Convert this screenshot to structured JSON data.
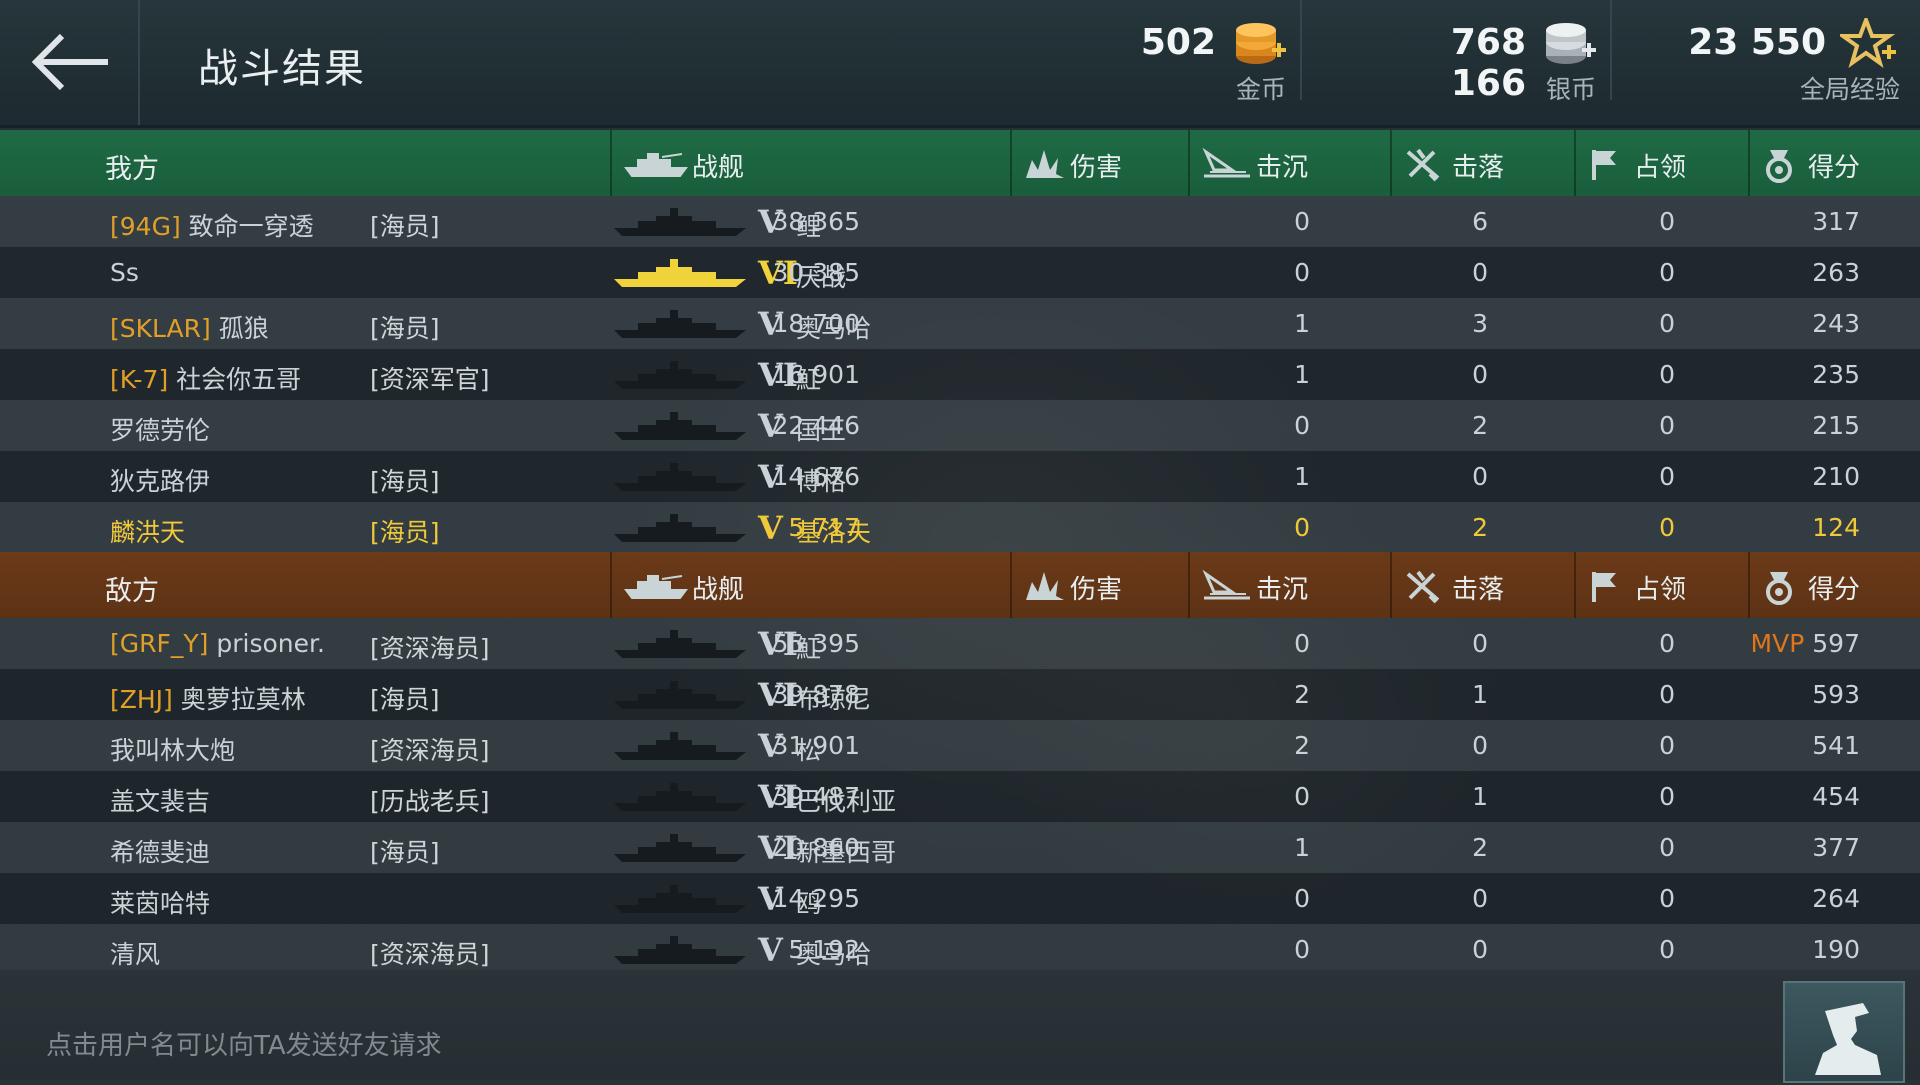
{
  "header": {
    "title": "战斗结果",
    "gold": {
      "value": "502",
      "label": "金币"
    },
    "silver": {
      "value": "768 166",
      "label": "银币"
    },
    "exp": {
      "value": "23 550",
      "label": "全局经验"
    }
  },
  "columns": {
    "ship": "战舰",
    "damage": "伤害",
    "sink": "击沉",
    "down": "击落",
    "capture": "占领",
    "score": "得分"
  },
  "friendly": {
    "title": "我方",
    "players": [
      {
        "clan": "[94G]",
        "name": "致命一穿透",
        "rank": "[海员]",
        "tier": "V",
        "ship": "鲤",
        "damage": "38 365",
        "sink": "0",
        "down": "6",
        "capture": "0",
        "score": "317"
      },
      {
        "clan": "",
        "name": "Ss",
        "rank": "",
        "tier": "VI",
        "ship": "厌战",
        "damage": "30 385",
        "sink": "0",
        "down": "0",
        "capture": "0",
        "score": "263"
      },
      {
        "clan": "[SKLAR]",
        "name": "孤狼",
        "rank": "[海员]",
        "tier": "V",
        "ship": "奥马哈",
        "damage": "18 700",
        "sink": "1",
        "down": "3",
        "capture": "0",
        "score": "243"
      },
      {
        "clan": "[K-7]",
        "name": "社会你五哥",
        "rank": "[资深军官]",
        "tier": "VI",
        "ship": "魟",
        "damage": "16 901",
        "sink": "1",
        "down": "0",
        "capture": "0",
        "score": "235"
      },
      {
        "clan": "",
        "name": "罗德劳伦",
        "rank": "",
        "tier": "V",
        "ship": "国王",
        "damage": "22 446",
        "sink": "0",
        "down": "2",
        "capture": "0",
        "score": "215"
      },
      {
        "clan": "",
        "name": "狄克路伊",
        "rank": "[海员]",
        "tier": "V",
        "ship": "博格",
        "damage": "14 676",
        "sink": "1",
        "down": "0",
        "capture": "0",
        "score": "210"
      },
      {
        "clan": "",
        "name": "麟洪天",
        "rank": "[海员]",
        "tier": "V",
        "ship": "基洛夫",
        "damage": "5 717",
        "sink": "0",
        "down": "2",
        "capture": "0",
        "score": "124"
      }
    ]
  },
  "enemy": {
    "title": "敌方",
    "players": [
      {
        "clan": "[GRF_Y]",
        "name": "prisoner.",
        "rank": "[资深海员]",
        "tier": "VI",
        "ship": "魟",
        "damage": "55 395",
        "sink": "0",
        "down": "0",
        "capture": "0",
        "mvp": "MVP",
        "score": "597"
      },
      {
        "clan": "[ZHJ]",
        "name": "奥萝拉莫林",
        "rank": "[海员]",
        "tier": "VI",
        "ship": "布琼尼",
        "damage": "39 878",
        "sink": "2",
        "down": "1",
        "capture": "0",
        "score": "593"
      },
      {
        "clan": "",
        "name": "我叫林大炮",
        "rank": "[资深海员]",
        "tier": "V",
        "ship": "松",
        "damage": "31 901",
        "sink": "2",
        "down": "0",
        "capture": "0",
        "score": "541"
      },
      {
        "clan": "",
        "name": "盖文裴吉",
        "rank": "[历战老兵]",
        "tier": "VI",
        "ship": "巴伐利亚",
        "damage": "39 487",
        "sink": "0",
        "down": "1",
        "capture": "0",
        "score": "454"
      },
      {
        "clan": "",
        "name": "希德斐迪",
        "rank": "[海员]",
        "tier": "VI",
        "ship": "新墨西哥",
        "damage": "20 860",
        "sink": "1",
        "down": "2",
        "capture": "0",
        "score": "377"
      },
      {
        "clan": "",
        "name": "莱茵哈特",
        "rank": "",
        "tier": "V",
        "ship": "鸥",
        "damage": "14 295",
        "sink": "0",
        "down": "0",
        "capture": "0",
        "score": "264"
      },
      {
        "clan": "",
        "name": "清风",
        "rank": "[资深海员]",
        "tier": "V",
        "ship": "奥马哈",
        "damage": "5 192",
        "sink": "0",
        "down": "0",
        "capture": "0",
        "score": "190"
      }
    ]
  },
  "footer": {
    "hint": "点击用户名可以向TA发送好友请求"
  },
  "colors": {
    "clan": "#e0a028",
    "highlight": "#f0c93a",
    "mvp": "#e0761c",
    "friendly_header": "#1f6a45",
    "enemy_header": "#6b3a19"
  }
}
